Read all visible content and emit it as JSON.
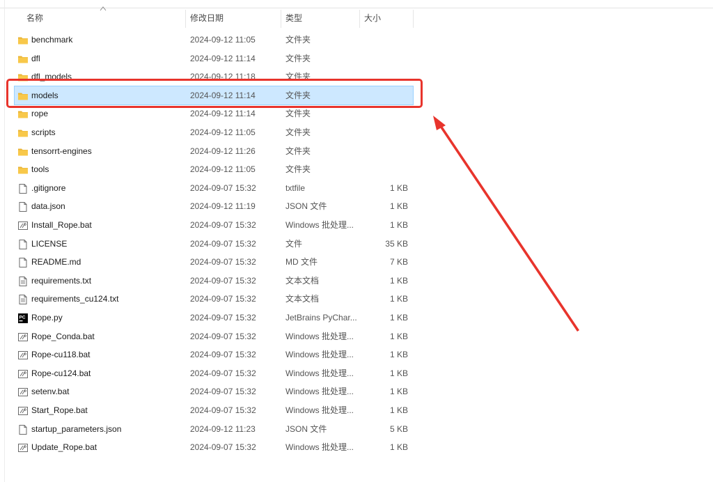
{
  "columns": {
    "name": "名称",
    "date": "修改日期",
    "type": "类型",
    "size": "大小"
  },
  "files": [
    {
      "name": "benchmark",
      "date": "2024-09-12 11:05",
      "type": "文件夹",
      "size": "",
      "icon": "folder-icon"
    },
    {
      "name": "dfl",
      "date": "2024-09-12 11:14",
      "type": "文件夹",
      "size": "",
      "icon": "folder-icon"
    },
    {
      "name": "dfl_models",
      "date": "2024-09-12 11:18",
      "type": "文件夹",
      "size": "",
      "icon": "folder-icon"
    },
    {
      "name": "models",
      "date": "2024-09-12 11:14",
      "type": "文件夹",
      "size": "",
      "icon": "folder-icon",
      "selected": true
    },
    {
      "name": "rope",
      "date": "2024-09-12 11:14",
      "type": "文件夹",
      "size": "",
      "icon": "folder-icon"
    },
    {
      "name": "scripts",
      "date": "2024-09-12 11:05",
      "type": "文件夹",
      "size": "",
      "icon": "folder-icon"
    },
    {
      "name": "tensorrt-engines",
      "date": "2024-09-12 11:26",
      "type": "文件夹",
      "size": "",
      "icon": "folder-icon"
    },
    {
      "name": "tools",
      "date": "2024-09-12 11:05",
      "type": "文件夹",
      "size": "",
      "icon": "folder-icon"
    },
    {
      "name": ".gitignore",
      "date": "2024-09-07 15:32",
      "type": "txtfile",
      "size": "1 KB",
      "icon": "file-icon"
    },
    {
      "name": "data.json",
      "date": "2024-09-12 11:19",
      "type": "JSON 文件",
      "size": "1 KB",
      "icon": "file-icon"
    },
    {
      "name": "Install_Rope.bat",
      "date": "2024-09-07 15:32",
      "type": "Windows 批处理...",
      "size": "1 KB",
      "icon": "batch-file-icon"
    },
    {
      "name": "LICENSE",
      "date": "2024-09-07 15:32",
      "type": "文件",
      "size": "35 KB",
      "icon": "file-icon"
    },
    {
      "name": "README.md",
      "date": "2024-09-07 15:32",
      "type": "MD 文件",
      "size": "7 KB",
      "icon": "file-icon"
    },
    {
      "name": "requirements.txt",
      "date": "2024-09-07 15:32",
      "type": "文本文档",
      "size": "1 KB",
      "icon": "text-file-icon"
    },
    {
      "name": "requirements_cu124.txt",
      "date": "2024-09-07 15:32",
      "type": "文本文档",
      "size": "1 KB",
      "icon": "text-file-icon"
    },
    {
      "name": "Rope.py",
      "date": "2024-09-07 15:32",
      "type": "JetBrains PyChar...",
      "size": "1 KB",
      "icon": "pycharm-icon"
    },
    {
      "name": "Rope_Conda.bat",
      "date": "2024-09-07 15:32",
      "type": "Windows 批处理...",
      "size": "1 KB",
      "icon": "batch-file-icon"
    },
    {
      "name": "Rope-cu118.bat",
      "date": "2024-09-07 15:32",
      "type": "Windows 批处理...",
      "size": "1 KB",
      "icon": "batch-file-icon"
    },
    {
      "name": "Rope-cu124.bat",
      "date": "2024-09-07 15:32",
      "type": "Windows 批处理...",
      "size": "1 KB",
      "icon": "batch-file-icon"
    },
    {
      "name": "setenv.bat",
      "date": "2024-09-07 15:32",
      "type": "Windows 批处理...",
      "size": "1 KB",
      "icon": "batch-file-icon"
    },
    {
      "name": "Start_Rope.bat",
      "date": "2024-09-07 15:32",
      "type": "Windows 批处理...",
      "size": "1 KB",
      "icon": "batch-file-icon"
    },
    {
      "name": "startup_parameters.json",
      "date": "2024-09-12 11:23",
      "type": "JSON 文件",
      "size": "5 KB",
      "icon": "file-icon"
    },
    {
      "name": "Update_Rope.bat",
      "date": "2024-09-07 15:32",
      "type": "Windows 批处理...",
      "size": "1 KB",
      "icon": "batch-file-icon"
    }
  ],
  "colors": {
    "selection_bg": "#cde8ff",
    "selection_border": "#99d1ff",
    "annotation_red": "#e8342c",
    "folder_yellow": "#f8c84a"
  }
}
